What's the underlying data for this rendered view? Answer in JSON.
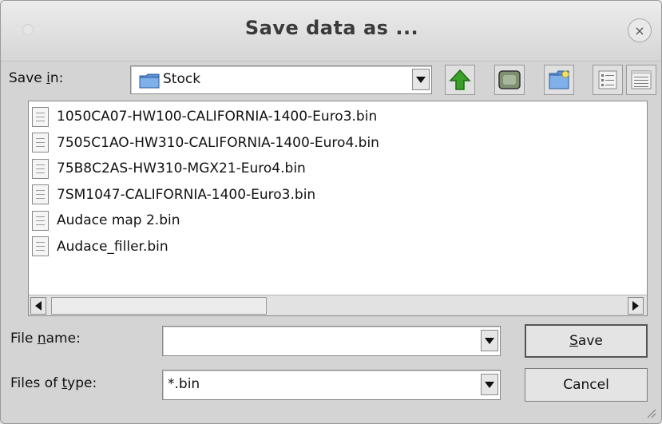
{
  "window": {
    "title": "Save data as ...",
    "close_glyph": "×"
  },
  "toolbar": {
    "save_in_label_pre": "Save ",
    "save_in_label_mnemonic": "i",
    "save_in_label_post": "n:",
    "location_value": "Stock",
    "buttons": [
      {
        "icon": "up-folder-icon"
      },
      {
        "icon": "desktop-icon"
      },
      {
        "icon": "new-folder-icon"
      },
      {
        "icon": "list-view-icon"
      },
      {
        "icon": "details-view-icon"
      }
    ]
  },
  "files": [
    "1050CA07-HW100-CALIFORNIA-1400-Euro3.bin",
    "7505C1AO-HW310-CALIFORNIA-1400-Euro4.bin",
    "75B8C2AS-HW310-MGX21-Euro4.bin",
    "7SM1047-CALIFORNIA-1400-Euro3.bin",
    "Audace map 2.bin",
    "Audace_filler.bin"
  ],
  "form": {
    "file_name_label_pre": "File ",
    "file_name_label_mnemonic": "n",
    "file_name_label_post": "ame:",
    "file_name_value": "",
    "file_type_label_pre": "Files of ",
    "file_type_label_mnemonic": "t",
    "file_type_label_post": "ype:",
    "file_type_value": "*.bin"
  },
  "buttons": {
    "save_mnemonic": "S",
    "save_rest": "ave",
    "cancel": "Cancel"
  },
  "colors": {
    "up_arrow": "#3aa02a",
    "folder": "#5b8fd6"
  }
}
